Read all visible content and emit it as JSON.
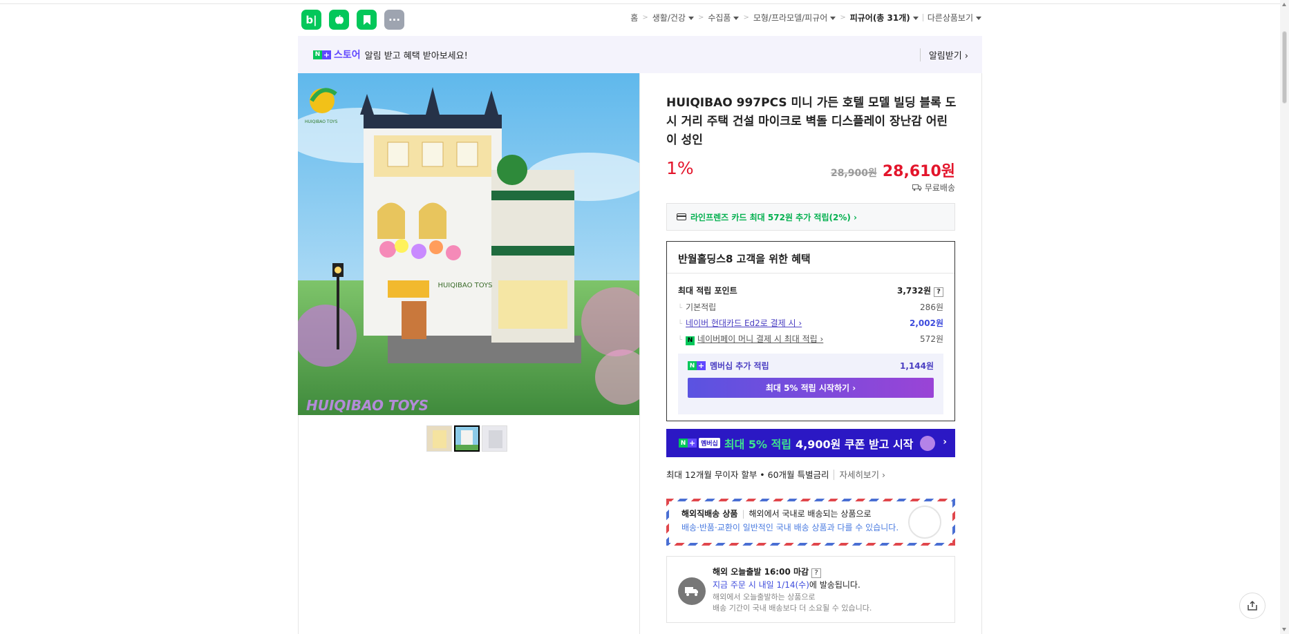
{
  "apps": [
    {
      "label": "b|",
      "icon": "blog-icon"
    },
    {
      "label": "",
      "icon": "apple-icon"
    },
    {
      "label": "",
      "icon": "bookmark-icon"
    },
    {
      "label": "···",
      "icon": "more-icon"
    }
  ],
  "breadcrumb": {
    "home": "홈",
    "items": [
      "생활/건강",
      "수집품",
      "모형/프라모델/피규어"
    ],
    "current": "피규어(총 31개)",
    "other": "다른상품보기"
  },
  "store_banner": {
    "n_badge": "N",
    "plus_badge": "+",
    "store_word": "스토어",
    "message": "알림 받고 혜택 받아보세요!",
    "alarm": "알림받기 ›"
  },
  "product": {
    "title": "HUIQIBAO 997PCS 미니 가든 호텔 모델 빌딩 블록 도시 거리 주택 건설 마이크로 벽돌 디스플레이 장난감 어린이 성인",
    "discount": "1%",
    "original_price": "28,900원",
    "final_price": "28,610원",
    "shipping": "무료배송",
    "brand_watermark": "HUIQIBAO TOYS",
    "building_sign": "HUIQIBAO TOYS",
    "logo_text": "HUIQIBAO TOYS"
  },
  "card_offer": "라인프렌즈 카드 최대 572원 추가 적립(2%) ›",
  "benefit": {
    "heading": "반월홀딩스8 고객을 위한 혜택",
    "max_label": "최대 적립 포인트",
    "max_value": "3,732원",
    "help": "?",
    "rows": [
      {
        "label": "기본적립",
        "value": "286원"
      },
      {
        "label": "네이버 현대카드 Ed2로 결제 시 ›",
        "value": "2,002원"
      },
      {
        "label": "네이버페이 머니 결제 시 최대 적립 ›",
        "value": "572원"
      }
    ],
    "npay_badge": "N",
    "membership_label": "멤버십 추가 적립",
    "membership_value": "1,144원",
    "membership_button": "최대 5% 적립 시작하기 ›"
  },
  "promo": {
    "tag": "멤버십",
    "highlight": "최대 5% 적립",
    "text": "4,900원 쿠폰 받고 시작",
    "arrow": "›"
  },
  "installment": {
    "text": "최대 12개월 무이자 할부 • 60개월 특별금리",
    "more": "자세히보기 ›"
  },
  "overseas": {
    "title": "해외직배송 상품",
    "desc": "해외에서 국내로 배송되는 상품으로",
    "note": "배송·반품·교환이 일반적인 국내 배송 상품과 다를 수 있습니다."
  },
  "today_ship": {
    "title": "해외 오늘출발 16:00 마감",
    "help": "?",
    "line_prefix": "지금 주문 시 내일 1/14(수)",
    "line_suffix": "에 발송됩니다.",
    "note1": "해외에서 오늘출발하는 상품으로",
    "note2": "배송 기간이 국내 배송보다 더 소요될 수 있습니다."
  },
  "colors": {
    "naver_green": "#03c75a",
    "price_red": "#e3152b",
    "membership_purple": "#4a3ec2",
    "promo_blue": "#2b18c4"
  }
}
